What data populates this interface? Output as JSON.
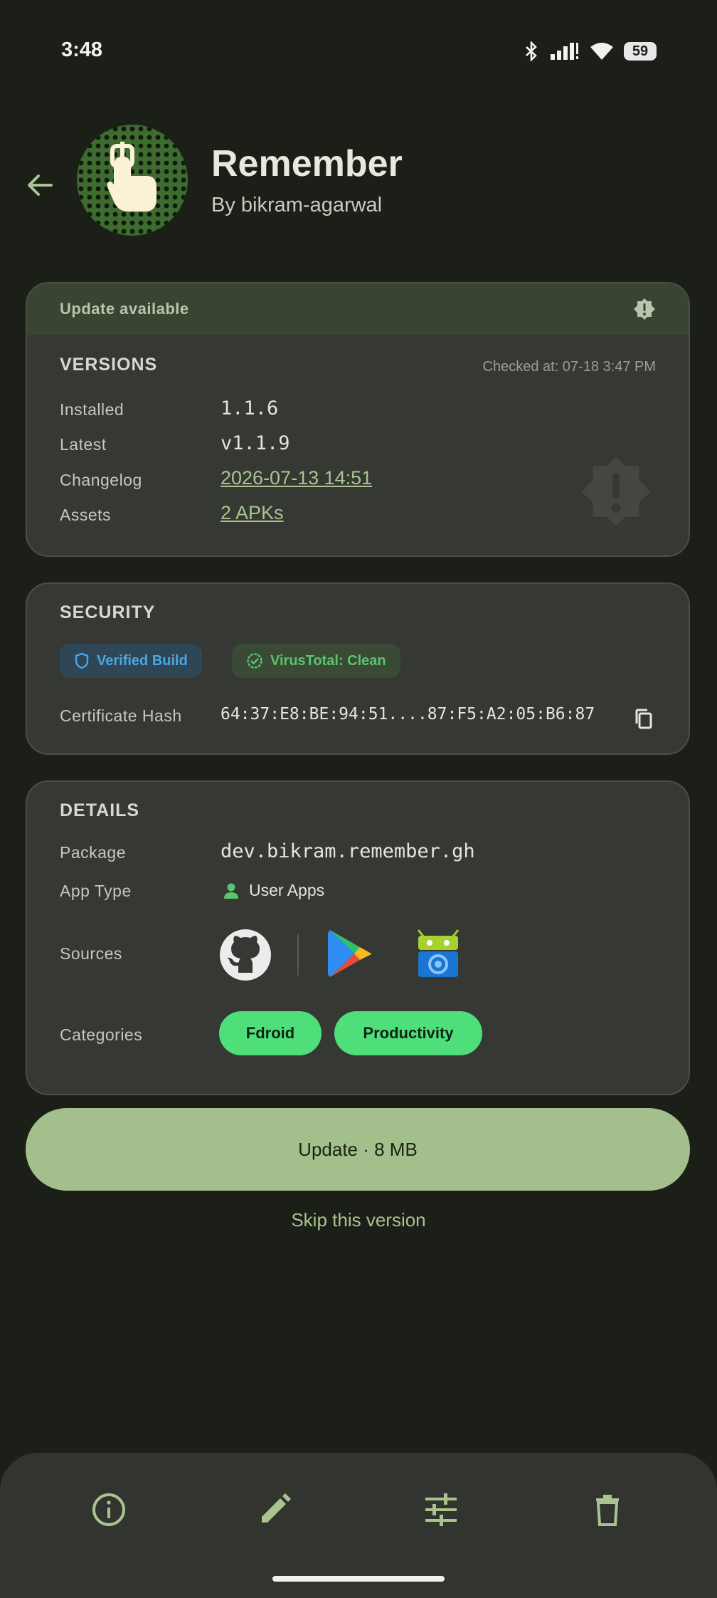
{
  "status": {
    "time": "3:48",
    "battery": "59"
  },
  "header": {
    "title": "Remember",
    "author": "By bikram-agarwal"
  },
  "versions": {
    "banner": "Update available",
    "title": "VERSIONS",
    "checked": "Checked at: 07-18 3:47 PM",
    "rows": [
      {
        "label": "Installed",
        "value": "1.1.6"
      },
      {
        "label": "Latest",
        "value": "v1.1.9"
      },
      {
        "label": "Changelog",
        "value": "2026-07-13 14:51"
      },
      {
        "label": "Assets",
        "value": "2 APKs"
      }
    ]
  },
  "security": {
    "title": "SECURITY",
    "badge_verified": "Verified Build",
    "badge_virus": "VirusTotal: Clean",
    "cert_label": "Certificate Hash",
    "cert_value": "64:37:E8:BE:94:51....87:F5:A2:05:B6:87"
  },
  "details": {
    "title": "DETAILS",
    "package_label": "Package",
    "package_value": "dev.bikram.remember.gh",
    "type_label": "App Type",
    "type_value": "User Apps",
    "sources_label": "Sources",
    "categories_label": "Categories",
    "categories": [
      "Fdroid",
      "Productivity"
    ]
  },
  "actions": {
    "update": "Update · 8 MB",
    "skip": "Skip this version"
  },
  "colors": {
    "accent": "#a3bf8c",
    "chip_green": "#4ede7a",
    "background": "#1b1f18"
  }
}
